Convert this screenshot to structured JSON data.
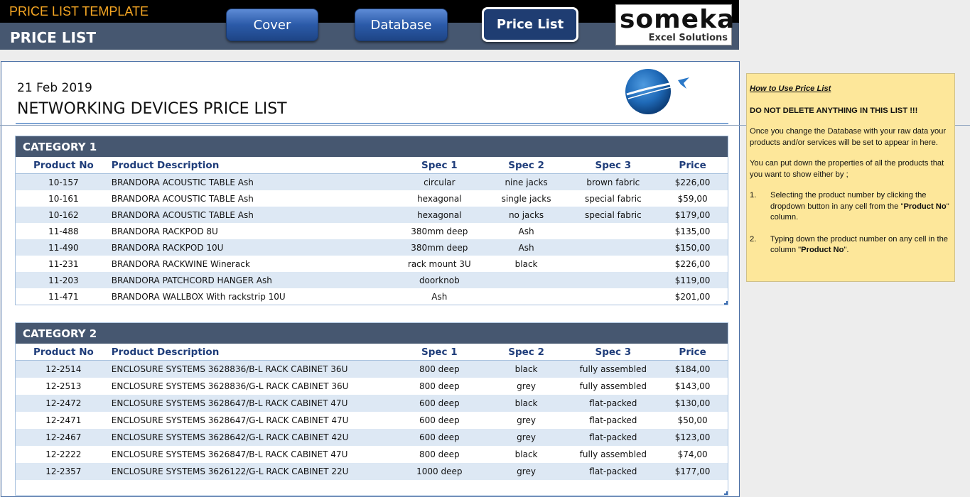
{
  "header": {
    "template_title": "PRICE LIST TEMPLATE",
    "page_heading": "PRICE LIST",
    "nav": [
      {
        "label": "Cover",
        "active": false
      },
      {
        "label": "Database",
        "active": false
      },
      {
        "label": "Price List",
        "active": true
      }
    ],
    "logo": {
      "main": "someka",
      "sub": "Excel Solutions"
    }
  },
  "document": {
    "date": "21 Feb 2019",
    "title": "NETWORKING DEVICES PRICE LIST"
  },
  "columns": [
    "Product No",
    "Product Description",
    "Spec 1",
    "Spec 2",
    "Spec 3",
    "Price"
  ],
  "categories": [
    {
      "name": "CATEGORY 1",
      "rows": [
        [
          "10-157",
          "BRANDORA ACOUSTIC TABLE Ash",
          "circular",
          "nine jacks",
          "brown fabric",
          "$226,00"
        ],
        [
          "10-161",
          "BRANDORA ACOUSTIC TABLE Ash",
          "hexagonal",
          "single jacks",
          "special fabric",
          "$59,00"
        ],
        [
          "10-162",
          "BRANDORA ACOUSTIC TABLE Ash",
          "hexagonal",
          "no jacks",
          "special fabric",
          "$179,00"
        ],
        [
          "11-488",
          "BRANDORA RACKPOD 8U",
          "380mm deep",
          "Ash",
          "",
          "$135,00"
        ],
        [
          "11-490",
          "BRANDORA RACKPOD 10U",
          "380mm deep",
          "Ash",
          "",
          "$150,00"
        ],
        [
          "11-231",
          "BRANDORA RACKWINE Winerack",
          "rack mount 3U",
          "black",
          "",
          "$226,00"
        ],
        [
          "11-203",
          "BRANDORA PATCHCORD HANGER Ash",
          "doorknob",
          "",
          "",
          "$119,00"
        ],
        [
          "11-471",
          "BRANDORA WALLBOX With rackstrip 10U",
          "Ash",
          "",
          "",
          "$201,00"
        ]
      ]
    },
    {
      "name": "CATEGORY 2",
      "rows": [
        [
          "12-2514",
          "ENCLOSURE SYSTEMS 3628836/B-L RACK CABINET 36U",
          "800 deep",
          "black",
          "fully assembled",
          "$184,00"
        ],
        [
          "12-2513",
          "ENCLOSURE SYSTEMS 3628836/G-L RACK CABINET 36U",
          "800 deep",
          "grey",
          "fully assembled",
          "$143,00"
        ],
        [
          "12-2472",
          "ENCLOSURE SYSTEMS 3628647/B-L RACK CABINET 47U",
          "600 deep",
          "black",
          "flat-packed",
          "$130,00"
        ],
        [
          "12-2471",
          "ENCLOSURE SYSTEMS 3628647/G-L RACK CABINET 47U",
          "600 deep",
          "grey",
          "flat-packed",
          "$50,00"
        ],
        [
          "12-2467",
          "ENCLOSURE SYSTEMS 3628642/G-L RACK CABINET 42U",
          "600 deep",
          "grey",
          "flat-packed",
          "$123,00"
        ],
        [
          "12-2222",
          "ENCLOSURE SYSTEMS 3626847/B-L RACK CABINET 47U",
          "800 deep",
          "black",
          "fully assembled",
          "$74,00"
        ],
        [
          "12-2357",
          "ENCLOSURE SYSTEMS 3626122/G-L RACK CABINET 22U",
          "1000 deep",
          "grey",
          "flat-packed",
          "$177,00"
        ]
      ]
    }
  ],
  "help": {
    "title": "How to Use Price List",
    "warning": "DO NOT DELETE ANYTHING IN THIS LIST !!!",
    "para1": "Once you change the Database with your raw data your products and/or services will be set to appear in here.",
    "para2": "You can put down the properties of all the products that you want to show either by ;",
    "item1_num": "1.",
    "item1_pre": "Selecting the product number by clicking the dropdown button in any cell from the \"",
    "item1_bold": "Product No",
    "item1_post": "\" column.",
    "item2_num": "2.",
    "item2_pre": "Typing down the product number on any cell in the column \"",
    "item2_bold": "Product No",
    "item2_post": "\"."
  },
  "colors": {
    "header_bar": "#465770",
    "nav_button": "#2b5aa8",
    "accent_orange": "#f5a623",
    "row_band": "#dde8f4",
    "help_bg": "#fde79a"
  },
  "icons": [
    "globe-plane-logo"
  ]
}
